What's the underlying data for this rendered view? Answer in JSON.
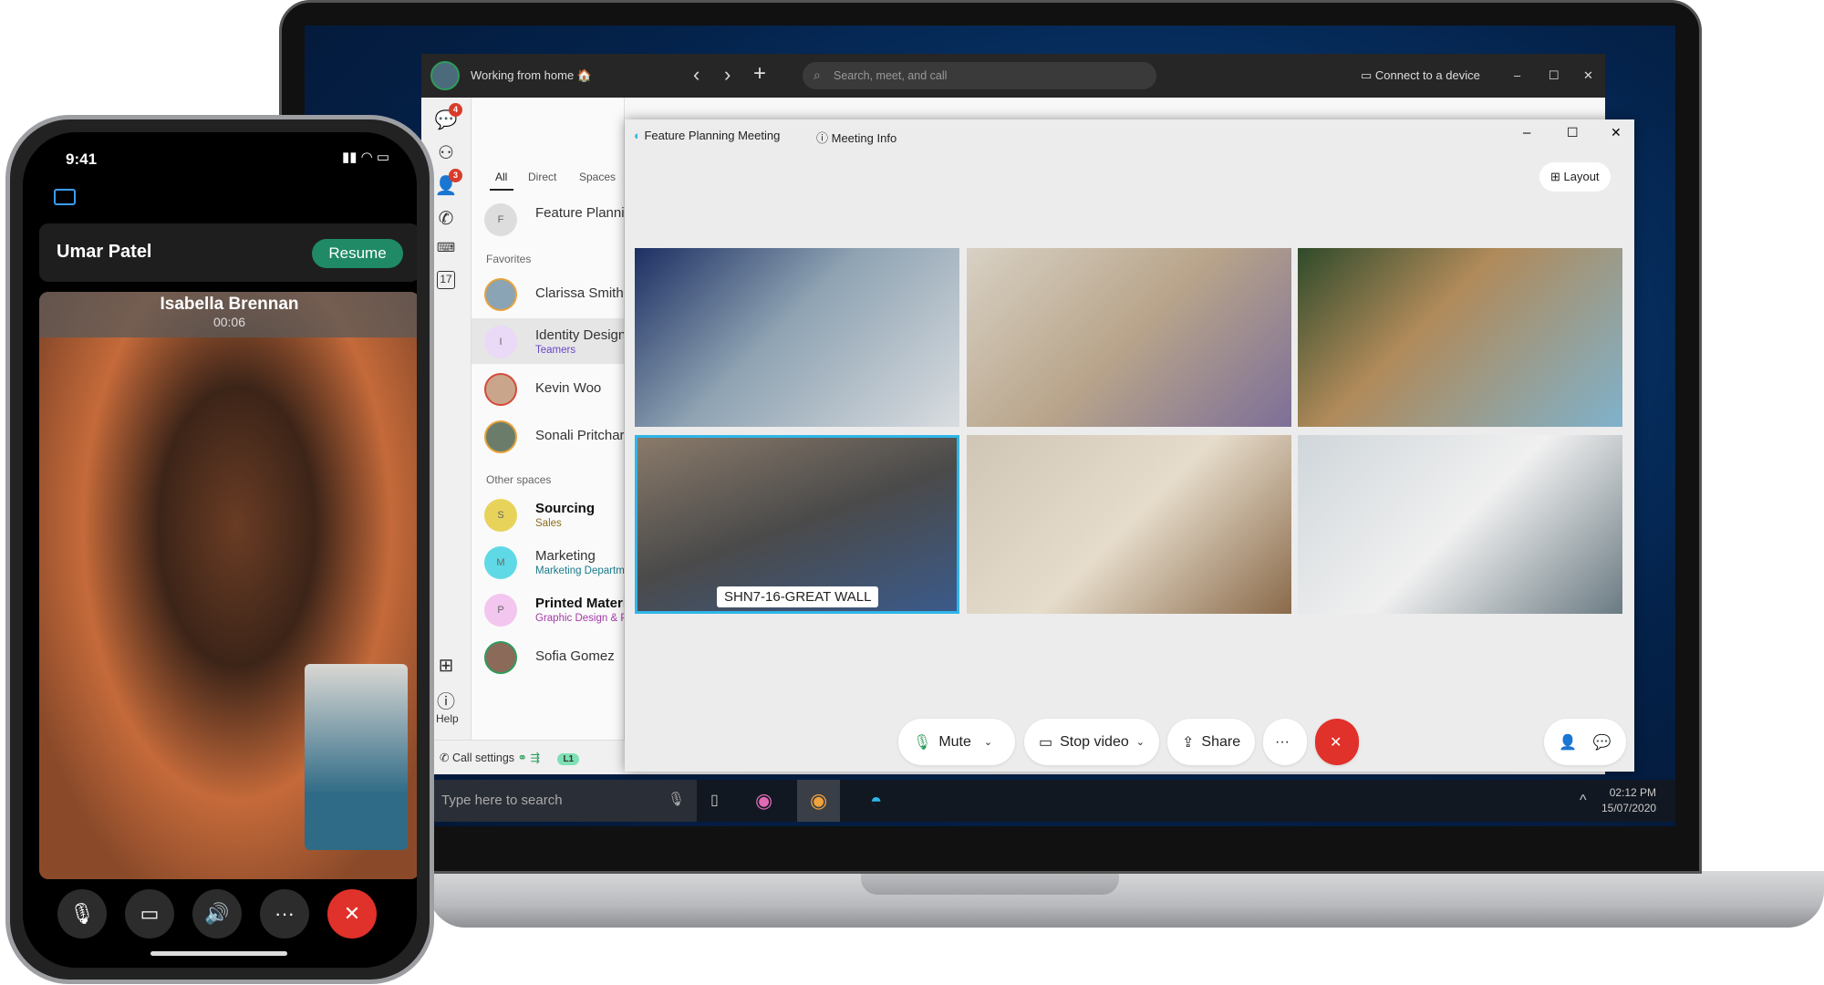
{
  "laptop": {
    "titlebar": {
      "status": "Working from home 🏠",
      "search_placeholder": "Search, meet, and call",
      "connect": "Connect to a device"
    },
    "rail": {
      "messages_badge": "4",
      "contacts_badge": "3",
      "calendar_day": "17",
      "help": "Help"
    },
    "list": {
      "tabs": [
        "All",
        "Direct",
        "Spaces"
      ],
      "top_item": {
        "initial": "F",
        "name": "Feature Planning"
      },
      "favorites_label": "Favorites",
      "favorites": [
        {
          "name": "Clarissa Smith"
        },
        {
          "initial": "I",
          "name": "Identity Design",
          "sub": "Teamers"
        },
        {
          "name": "Kevin Woo"
        },
        {
          "name": "Sonali Pritchard"
        }
      ],
      "other_label": "Other spaces",
      "others": [
        {
          "initial": "S",
          "name": "Sourcing",
          "sub": "Sales",
          "color": "#e8d35a",
          "subcolor": "#8a6d1a"
        },
        {
          "initial": "M",
          "name": "Marketing",
          "sub": "Marketing Department",
          "color": "#5fd9e6",
          "subcolor": "#1b7a8a"
        },
        {
          "initial": "P",
          "name": "Printed Materials",
          "sub": "Graphic Design & Print",
          "color": "#f3c6f0",
          "subcolor": "#a43aa8"
        },
        {
          "name": "Sofia Gomez"
        }
      ],
      "footer": {
        "call_settings": "Call settings",
        "line": "L1"
      }
    },
    "meeting": {
      "title": "Feature Planning Meeting",
      "info": "Meeting Info",
      "layout": "Layout",
      "room_label": "SHN7-16-GREAT WALL",
      "controls": {
        "mute": "Mute",
        "stop_video": "Stop video",
        "share": "Share",
        "more": "···"
      }
    },
    "taskbar": {
      "search": "Type here to search",
      "time": "02:12 PM",
      "date": "15/07/2020"
    }
  },
  "phone": {
    "time": "9:41",
    "held_caller": "Umar Patel",
    "resume": "Resume",
    "active_caller": "Isabella Brennan",
    "duration": "00:06"
  },
  "colors": {
    "accent_green": "#1f8a65",
    "end_call": "#e0312a",
    "selected_tile": "#2fb6e8"
  }
}
